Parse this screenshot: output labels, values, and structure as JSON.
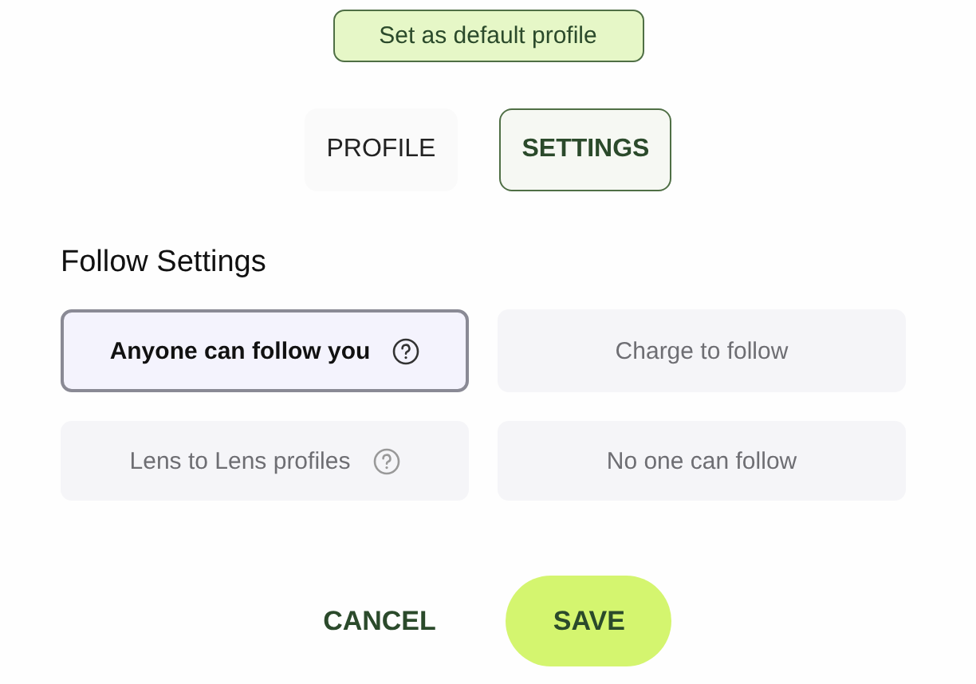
{
  "default_profile_button": {
    "label": "Set as default profile"
  },
  "tabs": [
    {
      "label": "PROFILE",
      "selected": false
    },
    {
      "label": "SETTINGS",
      "selected": true
    }
  ],
  "follow_settings": {
    "title": "Follow Settings",
    "options": [
      {
        "label": "Anyone can follow you",
        "selected": true,
        "help": true
      },
      {
        "label": "Charge to follow",
        "selected": false,
        "help": false
      },
      {
        "label": "Lens to Lens profiles",
        "selected": false,
        "help": true
      },
      {
        "label": "No one can follow",
        "selected": false,
        "help": false
      }
    ]
  },
  "actions": {
    "cancel": "CANCEL",
    "save": "SAVE"
  }
}
